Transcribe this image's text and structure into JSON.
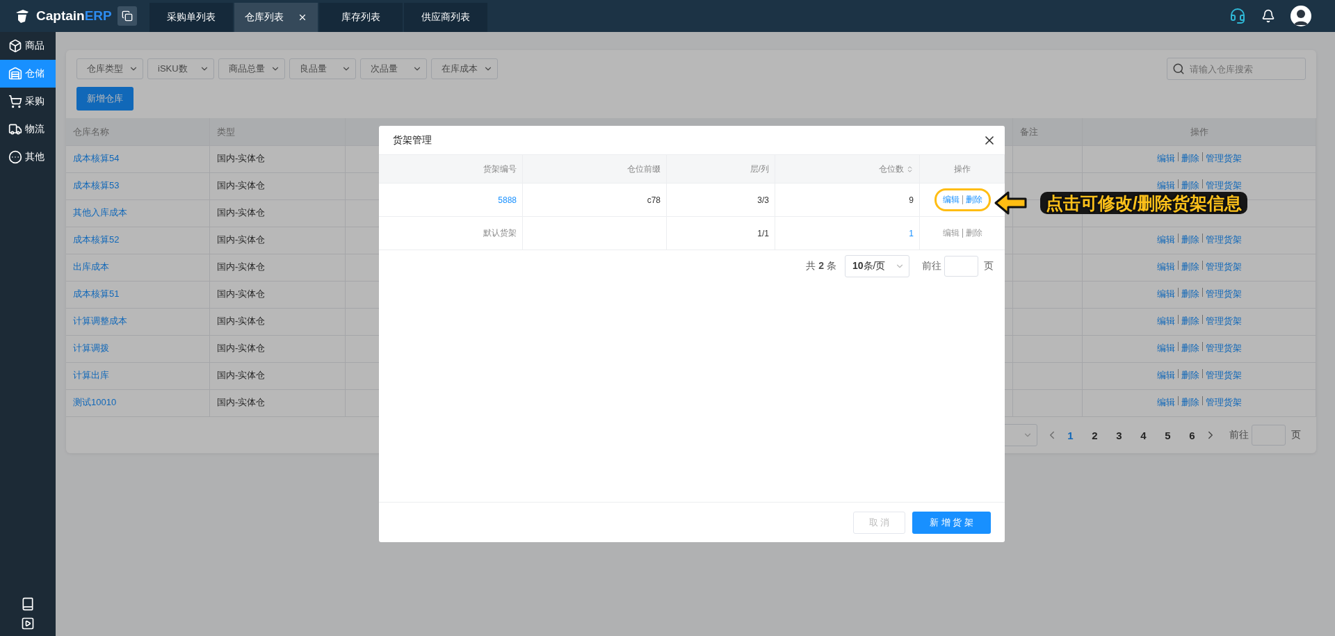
{
  "topbar": {
    "logo": {
      "text": "Captain",
      "accent": "ERP"
    },
    "tabs": [
      {
        "label": "采购单列表",
        "selected": false,
        "closable": false
      },
      {
        "label": "仓库列表",
        "selected": true,
        "closable": true
      },
      {
        "label": "库存列表",
        "selected": false,
        "closable": false
      },
      {
        "label": "供应商列表",
        "selected": false,
        "closable": false
      }
    ]
  },
  "sidebar": {
    "items": [
      {
        "label": "商品",
        "selected": false
      },
      {
        "label": "仓储",
        "selected": true
      },
      {
        "label": "采购",
        "selected": false
      },
      {
        "label": "物流",
        "selected": false
      },
      {
        "label": "其他",
        "selected": false
      }
    ]
  },
  "filters": [
    "仓库类型",
    "iSKU数",
    "商品总量",
    "良品量",
    "次品量",
    "在库成本"
  ],
  "search": {
    "placeholder": "请输入仓库搜索"
  },
  "add_button": "新增仓库",
  "table": {
    "columns": [
      "仓库名称",
      "类型",
      "备注",
      "操作"
    ],
    "rows": [
      {
        "name": "成本核算54",
        "type": "国内-实体仓",
        "actions": [
          "编辑",
          "删除",
          "管理货架"
        ]
      },
      {
        "name": "成本核算53",
        "type": "国内-实体仓",
        "actions": [
          "编辑",
          "删除",
          "管理货架"
        ]
      },
      {
        "name": "其他入库成本",
        "type": "国内-实体仓"
      },
      {
        "name": "成本核算52",
        "type": "国内-实体仓",
        "actions": [
          "编辑",
          "删除",
          "管理货架"
        ]
      },
      {
        "name": "出库成本",
        "type": "国内-实体仓",
        "actions": [
          "编辑",
          "删除",
          "管理货架"
        ]
      },
      {
        "name": "成本核算51",
        "type": "国内-实体仓",
        "actions": [
          "编辑",
          "删除",
          "管理货架"
        ]
      },
      {
        "name": "计算调整成本",
        "type": "国内-实体仓",
        "actions": [
          "编辑",
          "删除",
          "管理货架"
        ]
      },
      {
        "name": "计算调拨",
        "type": "国内-实体仓",
        "actions": [
          "编辑",
          "删除",
          "管理货架"
        ]
      },
      {
        "name": "计算出库",
        "type": "国内-实体仓",
        "actions": [
          "编辑",
          "删除",
          "管理货架"
        ]
      },
      {
        "name": "测试10010",
        "type": "国内-实体仓",
        "actions": [
          "编辑",
          "删除",
          "管理货架"
        ]
      }
    ]
  },
  "pagination": {
    "pages": [
      {
        "label": "1",
        "selected": true
      },
      {
        "label": "2",
        "selected": false
      },
      {
        "label": "3",
        "selected": false
      },
      {
        "label": "4",
        "selected": false
      },
      {
        "label": "5",
        "selected": false
      },
      {
        "label": "6",
        "selected": false
      }
    ],
    "goto_label": "前往",
    "goto_unit": "页"
  },
  "modal": {
    "title": "货架管理",
    "columns": [
      {
        "label": "货架编号",
        "sortable": false
      },
      {
        "label": "仓位前缀",
        "sortable": false
      },
      {
        "label": "层/列",
        "sortable": false
      },
      {
        "label": "仓位数",
        "sortable": true
      },
      {
        "label": "操作",
        "sortable": false
      }
    ],
    "rows": [
      {
        "shelf": {
          "text": "5888",
          "link": true
        },
        "prefix": "c78",
        "layers": "3/3",
        "count": {
          "text": "9",
          "link": false
        },
        "actions": [
          "编辑",
          "删除"
        ],
        "actions_disabled": false,
        "highlighted": true
      },
      {
        "shelf": {
          "text": "默认货架",
          "link": false
        },
        "layers": "1/1",
        "count": {
          "text": "1",
          "link": true
        },
        "actions": [
          "编辑",
          "删除"
        ],
        "actions_disabled": true,
        "highlighted": false
      }
    ],
    "pagination": {
      "total": "共 **2** 条",
      "page_size": "**10**条/页",
      "goto_label": "前往",
      "goto_unit": "页"
    },
    "cancel_button": {
      "label": "取 消",
      "disabled": true
    },
    "confirm_button": "新 增 货 架"
  },
  "annotation": {
    "text": "点击可修改/删除货架信息"
  }
}
